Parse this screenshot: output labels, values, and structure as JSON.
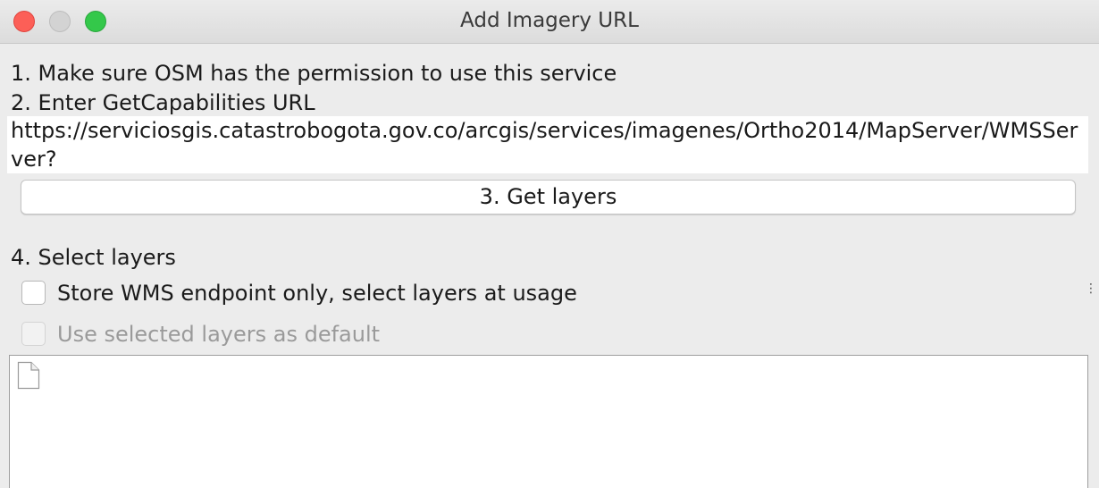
{
  "window": {
    "title": "Add Imagery URL"
  },
  "steps": {
    "step1": "1. Make sure OSM has the permission to use this service",
    "step2": "2. Enter GetCapabilities URL",
    "url_value": "https://serviciosgis.catastrobogota.gov.co/arcgis/services/imagenes/Ortho2014/MapServer/WMSServer?",
    "get_layers_label": "3. Get layers",
    "step4": "4. Select layers"
  },
  "options": {
    "store_endpoint_label": "Store WMS endpoint only, select layers at usage",
    "store_endpoint_checked": false,
    "use_default_label": "Use selected layers as default",
    "use_default_checked": false,
    "use_default_enabled": false
  },
  "icons": {
    "close": "close-traffic-light",
    "minimize": "minimize-traffic-light",
    "zoom": "zoom-traffic-light",
    "layer_list_item": "document-icon",
    "resize_grip": "resize-grip-icon"
  },
  "colors": {
    "close": "#fc5f57",
    "minimize_inactive": "#d3d3d3",
    "zoom": "#34c84a",
    "window_bg": "#ececec"
  }
}
